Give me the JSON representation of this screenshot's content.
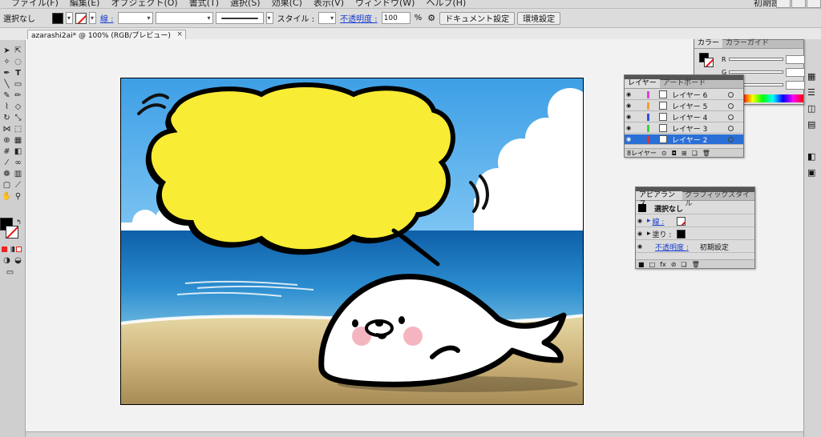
{
  "menu": {
    "items": [
      "ファイル(F)",
      "編集(E)",
      "オブジェクト(O)",
      "書式(T)",
      "選択(S)",
      "効果(C)",
      "表示(V)",
      "ウィンドウ(W)",
      "ヘルプ(H)"
    ],
    "workspace": "初期設定"
  },
  "control": {
    "selection_label": "選択なし",
    "stroke_label": "線 :",
    "style_label": "スタイル :",
    "opacity_label": "不透明度 :",
    "opacity_value": "100",
    "opacity_unit": "%",
    "document_settings": "ドキュメント設定",
    "preferences": "環境設定"
  },
  "document": {
    "tab_title": "azarashi2ai* @ 100% (RGB/プレビュー)",
    "tab_close": "×"
  },
  "color_panel": {
    "tabs": [
      "カラー",
      "カラーガイド"
    ],
    "sliders": [
      "R",
      "G",
      "B"
    ]
  },
  "layers_panel": {
    "tabs": [
      "レイヤー",
      "アートボード"
    ],
    "layers": [
      {
        "name": "レイヤー 6",
        "color": "#e040e0",
        "selected": false
      },
      {
        "name": "レイヤー 5",
        "color": "#f0a030",
        "selected": false
      },
      {
        "name": "レイヤー 4",
        "color": "#3050e0",
        "selected": false
      },
      {
        "name": "レイヤー 3",
        "color": "#40d040",
        "selected": false
      },
      {
        "name": "レイヤー 2",
        "color": "#e03030",
        "selected": true
      }
    ],
    "count_label": "8レイヤー"
  },
  "appearance_panel": {
    "tabs": [
      "アピアランス",
      "グラフィックスタイル"
    ],
    "title": "選択なし",
    "stroke_label": "線 :",
    "fill_label": "塗り :",
    "opacity_label": "不透明度 :",
    "opacity_value": "初期設定"
  },
  "colors": {
    "sky": "#4aa6e8",
    "bubble": "#f8ec34",
    "sea": "#1a78c2",
    "sand": "#c8b078",
    "selection": "#2a6fd6"
  }
}
